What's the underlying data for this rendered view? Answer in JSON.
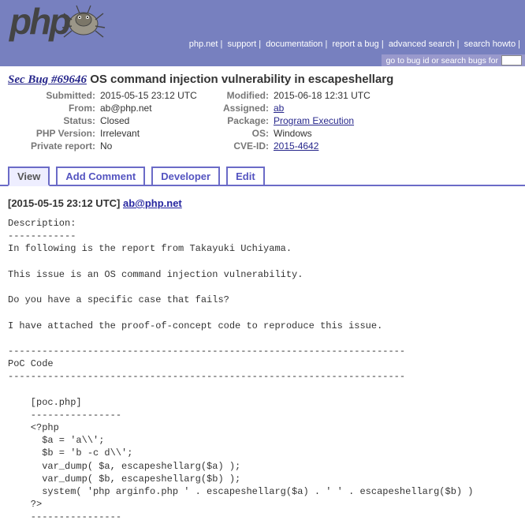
{
  "nav": {
    "items": [
      "php.net",
      "support",
      "documentation",
      "report a bug",
      "advanced search",
      "search howto"
    ],
    "sep": "|"
  },
  "search": {
    "label": "go to bug id or search bugs for",
    "value": ""
  },
  "bug": {
    "typeid": "Sec Bug #69646",
    "title": "OS command injection vulnerability in escapeshellarg",
    "fields": {
      "submitted_label": "Submitted:",
      "submitted_value": "2015-05-15 23:12 UTC",
      "modified_label": "Modified:",
      "modified_value": "2015-06-18 12:31 UTC",
      "from_label": "From:",
      "from_value": "ab@php.net",
      "assigned_label": "Assigned:",
      "assigned_value": "ab",
      "status_label": "Status:",
      "status_value": "Closed",
      "package_label": "Package:",
      "package_value": "Program Execution",
      "phpver_label": "PHP Version:",
      "phpver_value": "Irrelevant",
      "os_label": "OS:",
      "os_value": "Windows",
      "private_label": "Private report:",
      "private_value": "No",
      "cve_label": "CVE-ID:",
      "cve_value": "2015-4642"
    }
  },
  "tabs": {
    "view": "View",
    "add_comment": "Add Comment",
    "developer": "Developer",
    "edit": "Edit"
  },
  "comment": {
    "ts": "[2015-05-15 23:12 UTC]",
    "author": "ab@php.net",
    "body": "Description:\n------------\nIn following is the report from Takayuki Uchiyama.\n\nThis issue is an OS command injection vulnerability.\n\nDo you have a specific case that fails?\n\nI have attached the proof-of-concept code to reproduce this issue.\n\n----------------------------------------------------------------------\nPoC Code\n----------------------------------------------------------------------\n\n    [poc.php]\n    ----------------\n    <?php\n      $a = 'a\\\\';\n      $b = 'b -c d\\\\';\n      var_dump( $a, escapeshellarg($a) );\n      var_dump( $b, escapeshellarg($b) );\n      system( 'php arginfo.php ' . escapeshellarg($a) . ' ' . escapeshellarg($b) )\n    ?>\n    ----------------"
  }
}
